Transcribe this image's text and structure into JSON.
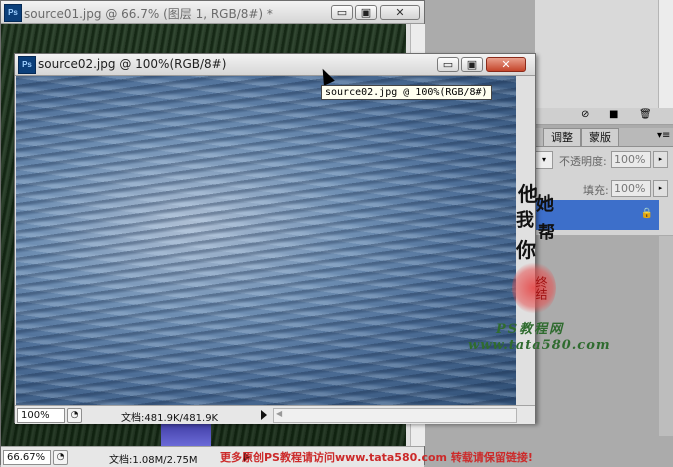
{
  "background_window": {
    "title": "source01.jpg @ 66.7% (图层 1, RGB/8#) *",
    "zoom": "66.67%",
    "doc_info": "文档:1.08M/2.75M"
  },
  "front_window": {
    "title": "source02.jpg @ 100%(RGB/8#)",
    "zoom": "100%",
    "doc_info": "文档:481.9K/481.9K"
  },
  "tooltip": "source02.jpg @ 100%(RGB/8#)",
  "caption_buttons": {
    "minimize": "▭",
    "restore": "▣",
    "close": "✕"
  },
  "layers_panel": {
    "tabs": [
      "调整",
      "蒙版"
    ],
    "opacity_label": "不透明度:",
    "opacity_value": "100%",
    "fill_label": "填充:",
    "fill_value": "100%"
  },
  "watermark": {
    "brush_chars": [
      "他",
      "她",
      "我",
      "帮",
      "你"
    ],
    "stamp_chars": "终结",
    "site_name": "PS教程网",
    "site_url": "www.tata580.com",
    "footer": "更多原创PS教程请访问www.tata580.com 转载请保留链接!"
  }
}
